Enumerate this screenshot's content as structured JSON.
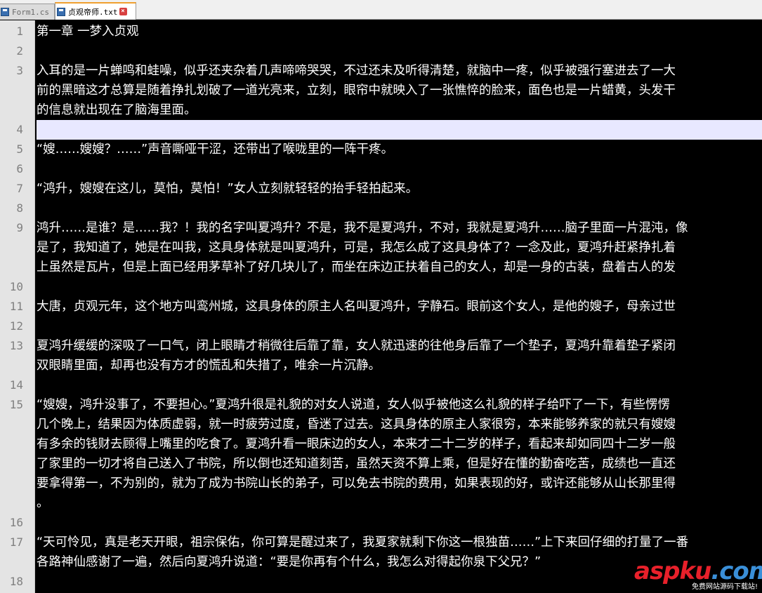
{
  "tabs": [
    {
      "label": "Form1.cs",
      "active": false,
      "icon": "floppy-icon"
    },
    {
      "label": "贞观帝师.txt",
      "active": true,
      "icon": "text-file-icon"
    }
  ],
  "editor": {
    "current_line": 4,
    "lines": [
      {
        "number": "1",
        "rows": [
          "第一章 一梦入贞观"
        ]
      },
      {
        "number": "2",
        "rows": [
          ""
        ]
      },
      {
        "number": "3",
        "rows": [
          "入耳的是一片蝉鸣和蛙噪，似乎还夹杂着几声啼啼哭哭，不过还未及听得清楚，就脑中一疼，似乎被强行塞进去了一大",
          "前的黑暗这才总算是随着挣扎划破了一道光亮来，立刻，眼帘中就映入了一张憔悴的脸来，面色也是一片蜡黄，头发干",
          "的信息就出现在了脑海里面。"
        ]
      },
      {
        "number": "4",
        "rows": [
          ""
        ]
      },
      {
        "number": "5",
        "rows": [
          "“嫂……嫂嫂？……”声音嘶哑干涩，还带出了喉咙里的一阵干疼。"
        ]
      },
      {
        "number": "6",
        "rows": [
          ""
        ]
      },
      {
        "number": "7",
        "rows": [
          "“鸿升，嫂嫂在这儿，莫怕，莫怕！”女人立刻就轻轻的抬手轻拍起来。"
        ]
      },
      {
        "number": "8",
        "rows": [
          ""
        ]
      },
      {
        "number": "9",
        "rows": [
          "鸿升……是谁？是……我？！我的名字叫夏鸿升？不是，我不是夏鸿升，不对，我就是夏鸿升……脑子里面一片混沌，像",
          "是了，我知道了，她是在叫我，这具身体就是叫夏鸿升，可是，我怎么成了这具身体了？一念及此，夏鸿升赶紧挣扎着",
          "上虽然是瓦片，但是上面已经用茅草补了好几块儿了，而坐在床边正扶着自己的女人，却是一身的古装，盘着古人的发"
        ]
      },
      {
        "number": "10",
        "rows": [
          ""
        ]
      },
      {
        "number": "11",
        "rows": [
          "大唐，贞观元年，这个地方叫鸾州城，这具身体的原主人名叫夏鸿升，字静石。眼前这个女人，是他的嫂子，母亲过世"
        ]
      },
      {
        "number": "12",
        "rows": [
          ""
        ]
      },
      {
        "number": "13",
        "rows": [
          "夏鸿升缓缓的深吸了一口气，闭上眼睛才稍微往后靠了靠，女人就迅速的往他身后靠了一个垫子，夏鸿升靠着垫子紧闭",
          "双眼睛里面，却再也没有方才的慌乱和失措了，唯余一片沉静。"
        ]
      },
      {
        "number": "14",
        "rows": [
          ""
        ]
      },
      {
        "number": "15",
        "rows": [
          "“嫂嫂，鸿升没事了，不要担心。”夏鸿升很是礼貌的对女人说道，女人似乎被他这么礼貌的样子给吓了一下，有些愣愣",
          "几个晚上，结果因为体质虚弱，就一时疲劳过度，昏迷了过去。这具身体的原主人家很穷，本来能够养家的就只有嫂嫂",
          "有多余的钱财去顾得上嘴里的吃食了。夏鸿升看一眼床边的女人，本来才二十二岁的样子，看起来却如同四十二岁一般",
          "了家里的一切才将自己送入了书院，所以倒也还知道刻苦，虽然天资不算上乘，但是好在懂的勤奋吃苦，成绩也一直还",
          "要拿得第一，不为别的，就为了成为书院山长的弟子，可以免去书院的费用，如果表现的好，或许还能够从山长那里得",
          "。"
        ]
      },
      {
        "number": "16",
        "rows": [
          ""
        ]
      },
      {
        "number": "17",
        "rows": [
          "“天可怜见，真是老天开眼，祖宗保佑，你可算是醒过来了，我夏家就剩下你这一根独苗……”上下来回仔细的打量了一番",
          "各路神仙感谢了一遍，然后向夏鸿升说道：“要是你再有个什么，我怎么对得起你泉下父兄？”"
        ]
      },
      {
        "number": "18",
        "rows": [
          ""
        ]
      }
    ]
  },
  "watermark": {
    "brand_part1": "asp",
    "brand_part2": "ku",
    "brand_part3": ".com",
    "subtitle": "免费网站源码下载站!"
  }
}
